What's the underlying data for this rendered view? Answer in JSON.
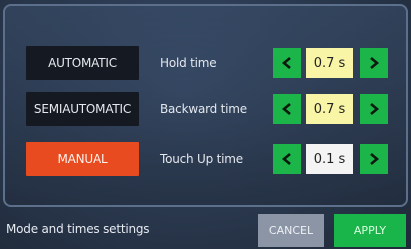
{
  "modes": {
    "automatic": "AUTOMATIC",
    "semiautomatic": "SEMIAUTOMATIC",
    "manual": "MANUAL",
    "selected": "MANUAL"
  },
  "settings": [
    {
      "label": "Hold time",
      "value": "0.7 s"
    },
    {
      "label": "Backward time",
      "value": "0.7 s"
    },
    {
      "label": "Touch Up time",
      "value": "0.1 s"
    }
  ],
  "footer": {
    "title": "Mode and times settings",
    "cancel_label": "CANCEL",
    "apply_label": "APPLY"
  },
  "colors": {
    "selected_mode": "#e84b1f",
    "stepper": "#1cb54a",
    "apply": "#19b44a",
    "cancel": "#8b95a6",
    "value_highlight": "#f8f6a6"
  },
  "icons": {
    "decrement": "chevron-left-icon",
    "increment": "chevron-right-icon"
  }
}
